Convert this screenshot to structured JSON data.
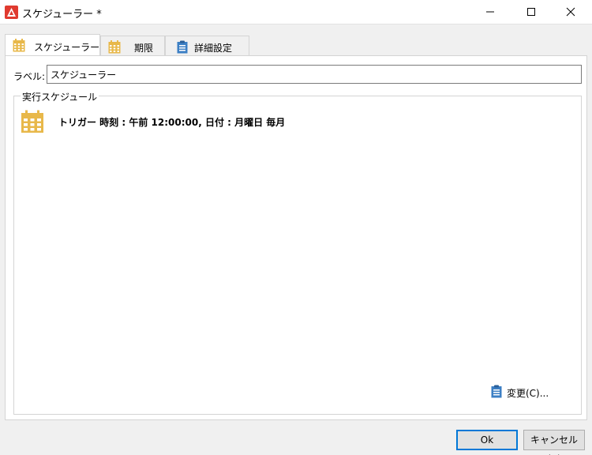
{
  "window": {
    "title": "スケジューラー *"
  },
  "tabs": [
    {
      "label": "スケジューラー",
      "icon": "calendar-icon"
    },
    {
      "label": "期限",
      "icon": "calendar-icon"
    },
    {
      "label": "詳細設定",
      "icon": "clipboard-icon"
    }
  ],
  "form": {
    "label_caption": "ラベル:",
    "label_value": "スケジューラー"
  },
  "schedule": {
    "group_title": "実行スケジュール",
    "trigger_text": "トリガー 時刻 : 午前 12:00:00, 日付 : 月曜日 毎月",
    "change_link": "変更(C)..."
  },
  "footer": {
    "ok_label": "Ok",
    "cancel_label": "キャンセル(A)"
  },
  "colors": {
    "accent": "#0078d7",
    "app_icon": "#e03a2f",
    "calendar_icon": "#e8b84a",
    "clipboard_icon": "#3c7fc4"
  }
}
